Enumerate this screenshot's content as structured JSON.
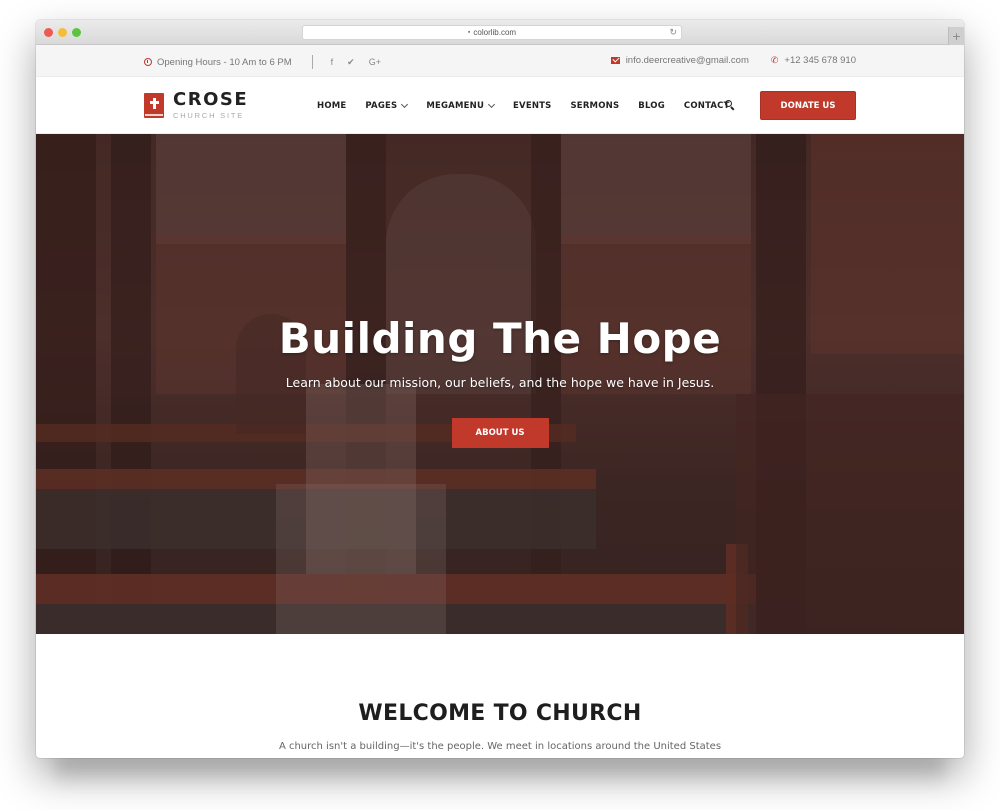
{
  "browser": {
    "url": "colorlib.com",
    "new_tab_symbol": "+",
    "reload_symbol": "↻",
    "lock_symbol": "🔒"
  },
  "topbar": {
    "opening_hours": "Opening Hours - 10 Am to 6 PM",
    "social": [
      {
        "icon": "facebook-icon",
        "glyph": "f"
      },
      {
        "icon": "twitter-icon",
        "glyph": "🐦"
      },
      {
        "icon": "google-plus-icon",
        "glyph": "G+"
      }
    ],
    "email": "info.deercreative@gmail.com",
    "phone": "+12 345 678 910",
    "phone_glyph": "📞"
  },
  "header": {
    "logo_title": "CROSE",
    "logo_subtitle": "CHURCH SITE",
    "menu": [
      {
        "label": "HOME",
        "has_dropdown": false
      },
      {
        "label": "PAGES",
        "has_dropdown": true
      },
      {
        "label": "MEGAMENU",
        "has_dropdown": true
      },
      {
        "label": "EVENTS",
        "has_dropdown": false
      },
      {
        "label": "SERMONS",
        "has_dropdown": false
      },
      {
        "label": "BLOG",
        "has_dropdown": false
      },
      {
        "label": "CONTACT",
        "has_dropdown": false
      }
    ],
    "donate_label": "DONATE US"
  },
  "hero": {
    "title": "Building The Hope",
    "subtitle": "Learn about our mission, our beliefs, and the hope we have in Jesus.",
    "cta_label": "ABOUT US"
  },
  "welcome": {
    "title": "WELCOME TO CHURCH",
    "text": "A church isn't a building—it's the people. We meet in locations around the United States and globally at Life.Church Online. No matter where you join,"
  },
  "colors": {
    "accent": "#c0392b",
    "topbar_bg": "#f5f5f5",
    "heading": "#1e1e1e"
  }
}
